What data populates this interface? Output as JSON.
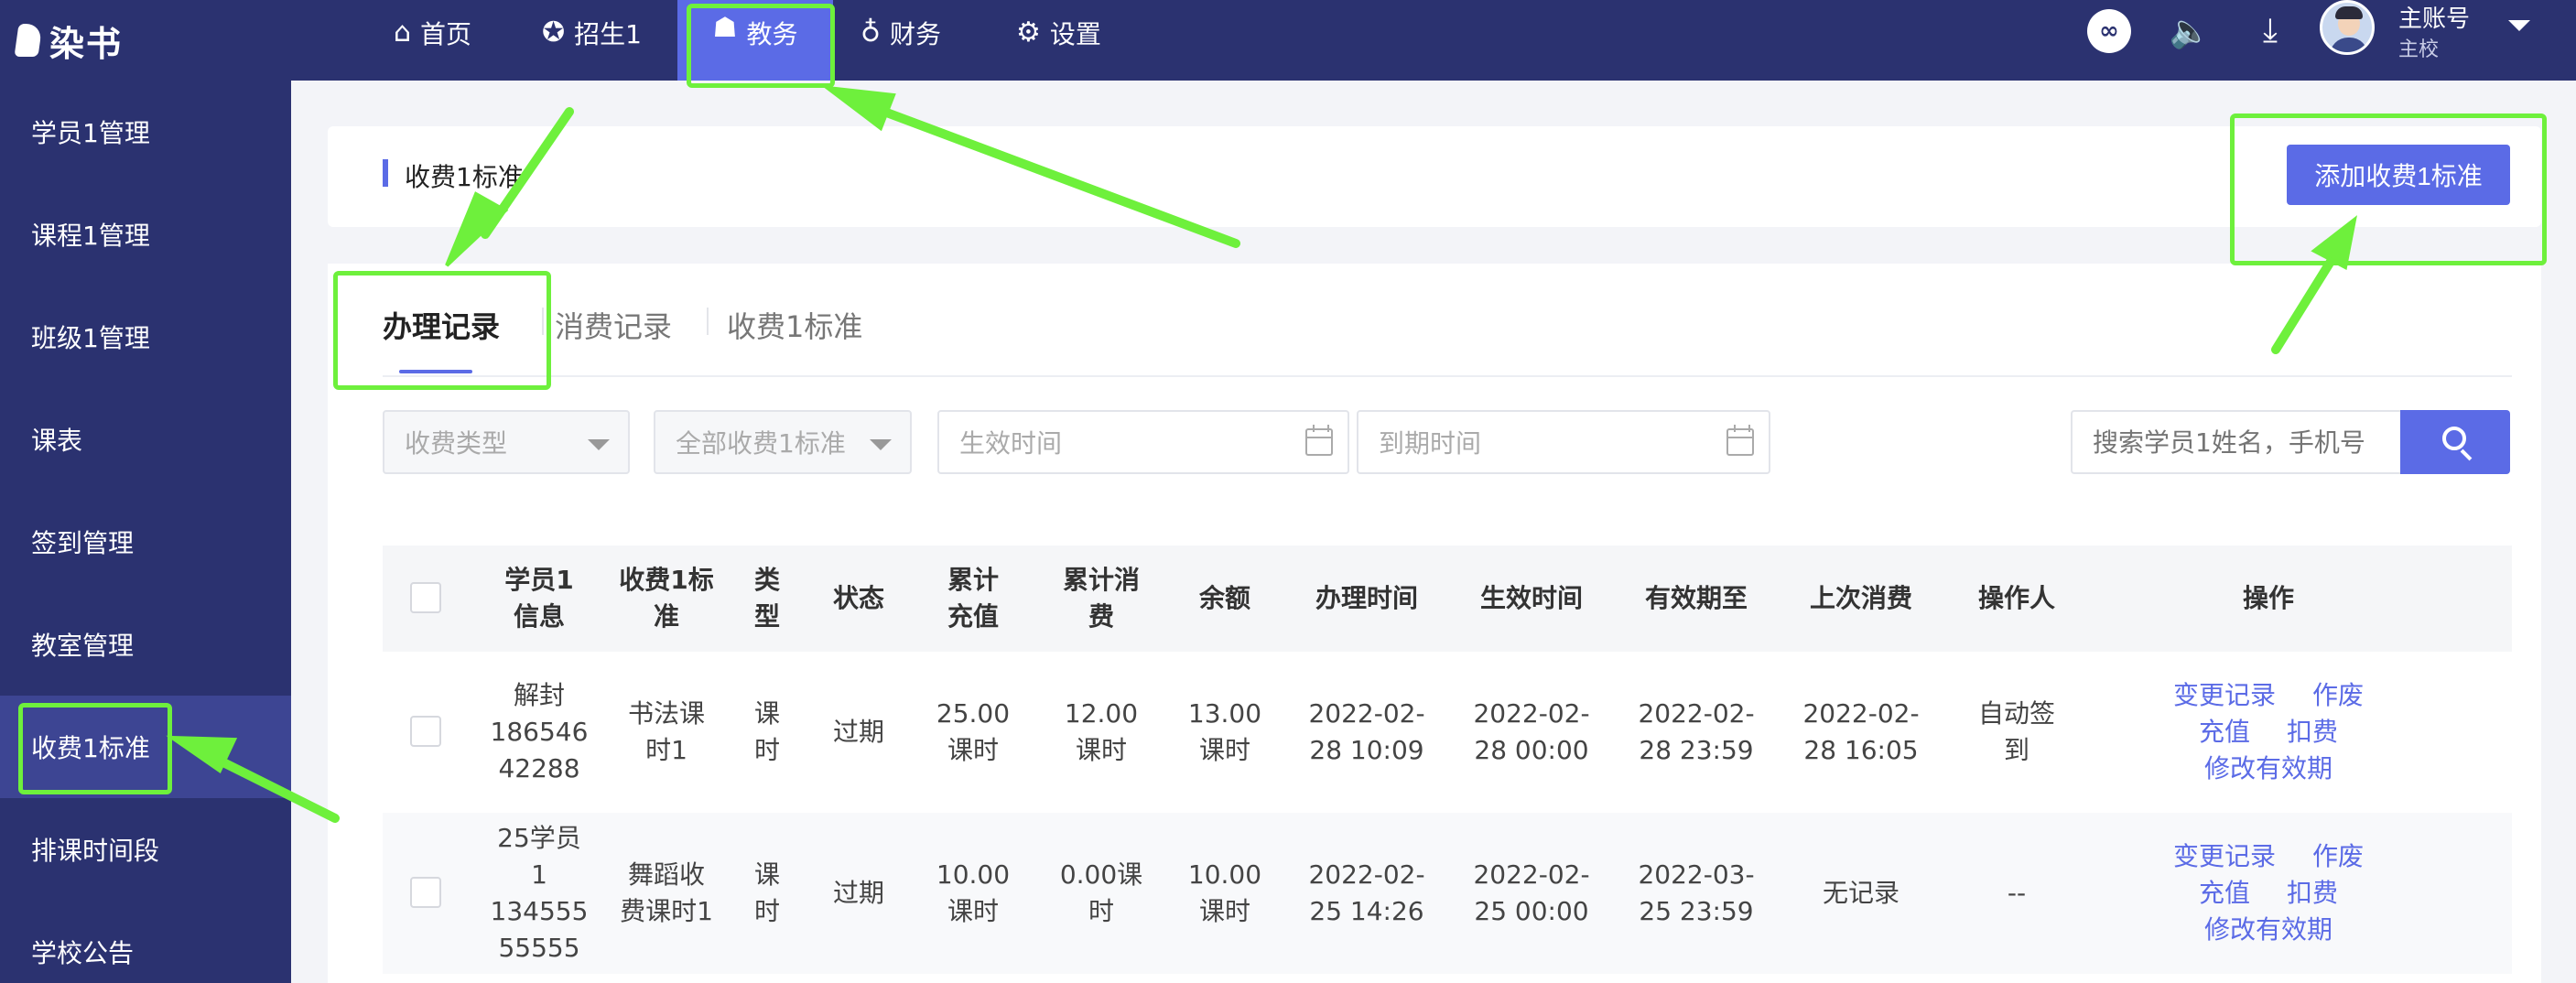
{
  "app": {
    "logo_text": "染书"
  },
  "topnav": {
    "items": [
      {
        "label": "首页",
        "icon": "home-icon"
      },
      {
        "label": "招生1",
        "icon": "recruit-icon"
      },
      {
        "label": "教务",
        "icon": "graduation-cap-icon"
      },
      {
        "label": "财务",
        "icon": "money-bag-icon"
      },
      {
        "label": "设置",
        "icon": "gear-icon"
      }
    ],
    "right_icons": [
      "link-icon",
      "speaker-icon",
      "download-icon"
    ],
    "account_name": "主账号",
    "account_sub": "主校"
  },
  "sidebar": {
    "items": [
      {
        "label": "学员1管理"
      },
      {
        "label": "课程1管理"
      },
      {
        "label": "班级1管理"
      },
      {
        "label": "课表"
      },
      {
        "label": "签到管理"
      },
      {
        "label": "教室管理"
      },
      {
        "label": "收费1标准"
      },
      {
        "label": "排课时间段"
      },
      {
        "label": "学校公告"
      }
    ]
  },
  "header": {
    "title": "收费1标准",
    "add_label": "添加收费1标准"
  },
  "tabs": [
    {
      "label": "办理记录"
    },
    {
      "label": "消费记录"
    },
    {
      "label": "收费1标准"
    }
  ],
  "filters": {
    "fee_type": "收费类型",
    "fee_standard": "全部收费1标准",
    "start_date": "生效时间",
    "end_date": "到期时间",
    "search_placeholder": "搜索学员1姓名，手机号"
  },
  "table": {
    "headers": [
      "学员1\n信息",
      "收费1标\n准",
      "类\n型",
      "状态",
      "累计\n充值",
      "累计消\n费",
      "余额",
      "办理时间",
      "生效时间",
      "有效期至",
      "上次消费",
      "操作人",
      "操作"
    ],
    "rows": [
      {
        "student": "解封\n186546\n42288",
        "standard": "书法课\n时1",
        "type": "课\n时",
        "status": "过期",
        "recharge": "25.00\n课时",
        "consumed": "12.00\n课时",
        "balance": "13.00\n课时",
        "handled": "2022-02-\n28 10:09",
        "effective": "2022-02-\n28 00:00",
        "valid_until": "2022-02-\n28 23:59",
        "last_consume": "2022-02-\n28 16:05",
        "operator": "自动签\n到",
        "ops": [
          "变更记录",
          "作废",
          "充值",
          "扣费",
          "修改有效期"
        ]
      },
      {
        "student": "25学员\n1\n134555\n55555",
        "standard": "舞蹈收\n费课时1",
        "type": "课\n时",
        "status": "过期",
        "recharge": "10.00\n课时",
        "consumed": "0.00课\n时",
        "balance": "10.00\n课时",
        "handled": "2022-02-\n25 14:26",
        "effective": "2022-02-\n25 00:00",
        "valid_until": "2022-03-\n25 23:59",
        "last_consume": "无记录",
        "operator": "--",
        "ops": [
          "变更记录",
          "作废",
          "充值",
          "扣费",
          "修改有效期"
        ]
      }
    ]
  },
  "colors": {
    "nav_bg": "#2b3270",
    "accent": "#5b6be6",
    "annotation": "#6ef03c"
  }
}
